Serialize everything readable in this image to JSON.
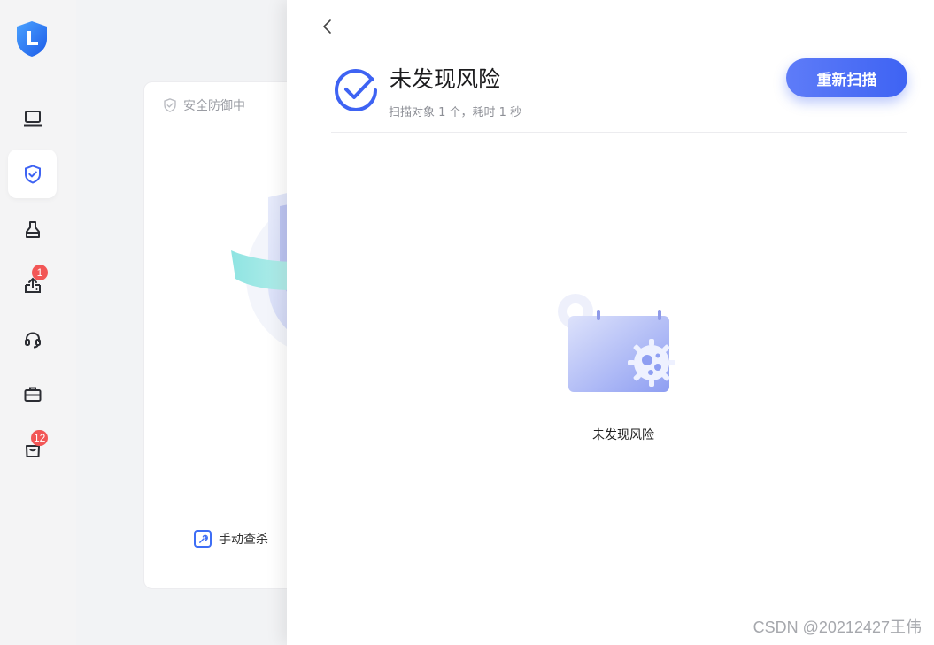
{
  "sidebar": {
    "logo_icon": "app-logo-shield-icon",
    "items": [
      {
        "name": "computer",
        "icon": "laptop-icon",
        "active": false
      },
      {
        "name": "security",
        "icon": "shield-check-icon",
        "active": true
      },
      {
        "name": "cleanup",
        "icon": "broom-icon",
        "active": false
      },
      {
        "name": "software",
        "icon": "tray-upload-icon",
        "active": false,
        "badge": "1"
      },
      {
        "name": "support",
        "icon": "headset-icon",
        "active": false
      },
      {
        "name": "toolbox",
        "icon": "toolbox-icon",
        "active": false
      },
      {
        "name": "store",
        "icon": "shopping-bag-icon",
        "active": false,
        "badge": "12"
      }
    ]
  },
  "defense_card": {
    "status": "安全防御中",
    "manual_scan": "手动查杀"
  },
  "panel": {
    "result_title": "未发现风险",
    "result_summary": "扫描对象 1 个，耗时 1 秒",
    "rescan_button": "重新扫描",
    "empty_label": "未发现风险"
  },
  "colors": {
    "accent": "#3e63f3",
    "badge": "#f25656"
  },
  "watermark": "CSDN @20212427王伟"
}
